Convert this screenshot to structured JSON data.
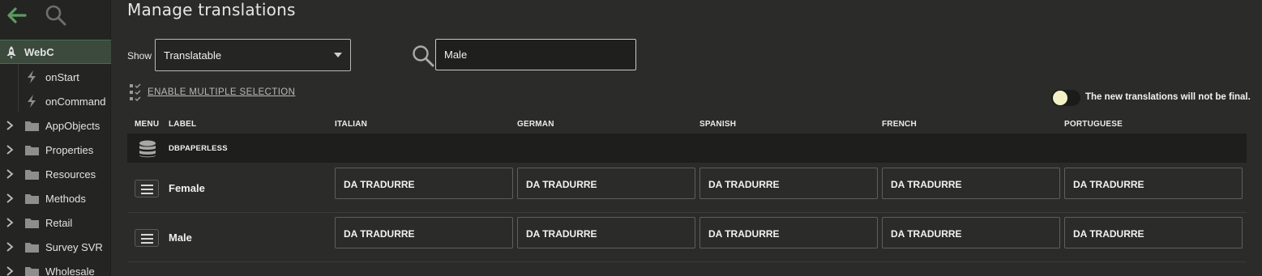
{
  "sidebar": {
    "items": [
      {
        "label": "WebC",
        "icon": "rocket-icon"
      },
      {
        "label": "onStart",
        "icon": "bolt-icon"
      },
      {
        "label": "onCommand",
        "icon": "bolt-icon"
      },
      {
        "label": "AppObjects",
        "icon": "folder-icon"
      },
      {
        "label": "Properties",
        "icon": "folder-icon"
      },
      {
        "label": "Resources",
        "icon": "folder-icon"
      },
      {
        "label": "Methods",
        "icon": "folder-icon"
      },
      {
        "label": "Retail",
        "icon": "folder-icon"
      },
      {
        "label": "Survey SVR",
        "icon": "folder-icon"
      },
      {
        "label": "Wholesale",
        "icon": "folder-icon"
      }
    ]
  },
  "header": {
    "title": "Manage translations",
    "show_label": "Show",
    "show_value": "Translatable",
    "search_value": "Male",
    "multi_selection_label": "ENABLE MULTIPLE SELECTION",
    "toggle_label": "The new translations will not be final.",
    "toggle_on": false
  },
  "table": {
    "columns": {
      "menu": "MENU",
      "label": "LABEL",
      "languages": [
        "ITALIAN",
        "GERMAN",
        "SPANISH",
        "FRENCH",
        "PORTUGUESE"
      ]
    },
    "group": "DBPAPERLESS",
    "rows": [
      {
        "label": "Female",
        "values": [
          "DA TRADURRE",
          "DA TRADURRE",
          "DA TRADURRE",
          "DA TRADURRE",
          "DA TRADURRE"
        ]
      },
      {
        "label": "Male",
        "values": [
          "DA TRADURRE",
          "DA TRADURRE",
          "DA TRADURRE",
          "DA TRADURRE",
          "DA TRADURRE"
        ]
      }
    ]
  },
  "colors": {
    "accent_green": "#5d9a63",
    "background": "#2b2c2a",
    "sidebar": "#242523",
    "toggle_knob": "#f3f0c8"
  }
}
